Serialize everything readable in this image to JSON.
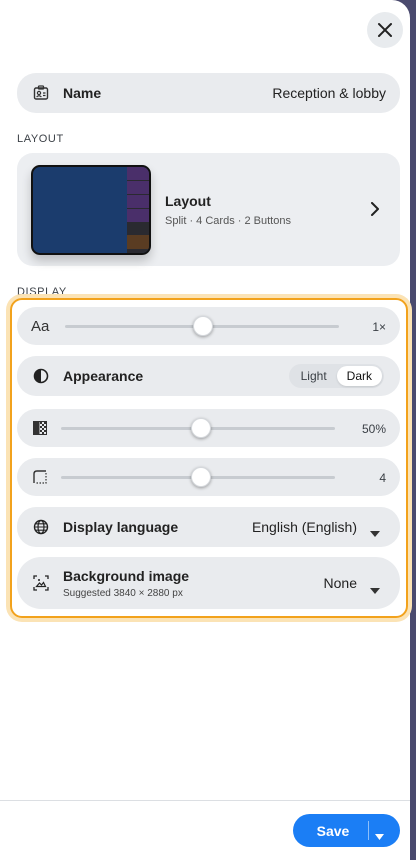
{
  "name_row": {
    "label": "Name",
    "value": "Reception & lobby"
  },
  "layout_section": {
    "heading": "LAYOUT",
    "card_title": "Layout",
    "card_subtitle": "Split · 4 Cards · 2 Buttons",
    "thumbnail_colors": [
      "#1b3c6d",
      "#4a2f6a",
      "#2a2a30",
      "#5a3c22"
    ]
  },
  "display_section": {
    "heading": "DISPLAY",
    "text_size": {
      "icon_text": "Aa",
      "value_label": "1×",
      "level": 0.5
    },
    "appearance": {
      "label": "Appearance",
      "options": [
        "Light",
        "Dark"
      ],
      "selected": "Dark"
    },
    "opacity": {
      "value_label": "50%",
      "level": 0.5
    },
    "corner_radius": {
      "value_label": "4",
      "level": 0.5
    },
    "language": {
      "label": "Display language",
      "value": "English (English)"
    },
    "background": {
      "label": "Background image",
      "hint": "Suggested 3840 × 2880 px",
      "value": "None"
    }
  },
  "footer": {
    "save_label": "Save"
  },
  "colors": {
    "accent": "#1b7ef5",
    "highlight": "#f2a21c",
    "row_bg": "#e9ebee"
  }
}
